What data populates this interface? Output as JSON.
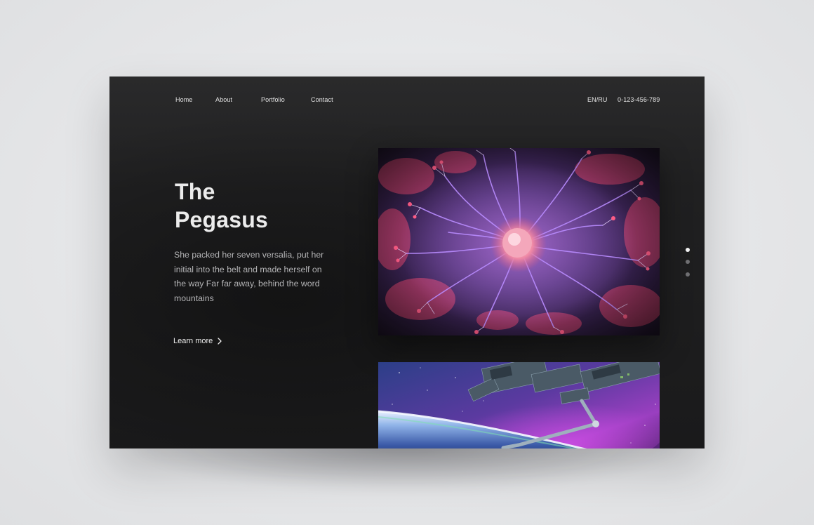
{
  "nav": {
    "items": [
      {
        "label": "Home"
      },
      {
        "label": "About"
      },
      {
        "label": "Portfolio"
      },
      {
        "label": "Contact"
      }
    ],
    "lang": "EN/RU",
    "phone": "0-123-456-789"
  },
  "hero": {
    "title_line1": "The",
    "title_line2": "Pegasus",
    "description": "She packed her seven versalia, put her initial into the belt and made herself on the way Far far away, behind the word mountains",
    "cta_label": "Learn more",
    "cta_icon": "chevron-right-icon"
  },
  "gallery": {
    "images": [
      {
        "subject": "plasma-ball-image"
      },
      {
        "subject": "space-station-image"
      }
    ]
  },
  "pager": {
    "count": 3,
    "active_index": 0
  },
  "colors": {
    "background": "#1c1c1d",
    "text": "#ececec",
    "muted_text": "#b4b4b6",
    "dot_active": "#f1f1f1",
    "dot_inactive": "#6f6f72"
  }
}
